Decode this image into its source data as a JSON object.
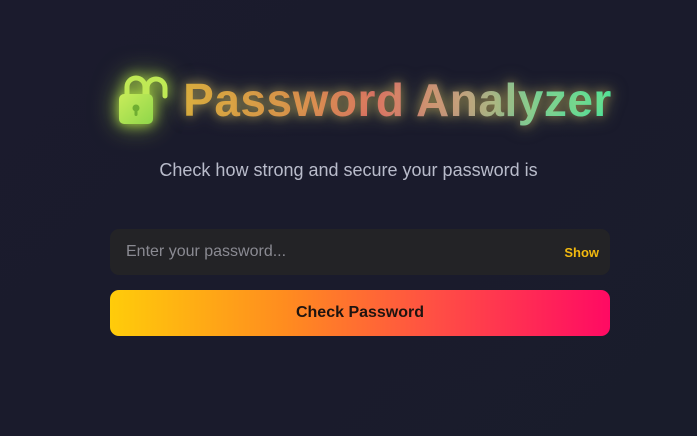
{
  "header": {
    "title": "Password Analyzer",
    "icon": "lock-icon",
    "subtitle": "Check how strong and secure your password is"
  },
  "form": {
    "password_placeholder": "Enter your password...",
    "password_value": "",
    "show_label": "Show",
    "submit_label": "Check Password"
  },
  "colors": {
    "background": "#1b1b2d",
    "input_background": "#232326",
    "show_toggle": "#f2b90f",
    "button_gradient_start": "#ffcc0a",
    "button_gradient_end": "#ff0a63",
    "lock_icon": "#b4e646"
  }
}
